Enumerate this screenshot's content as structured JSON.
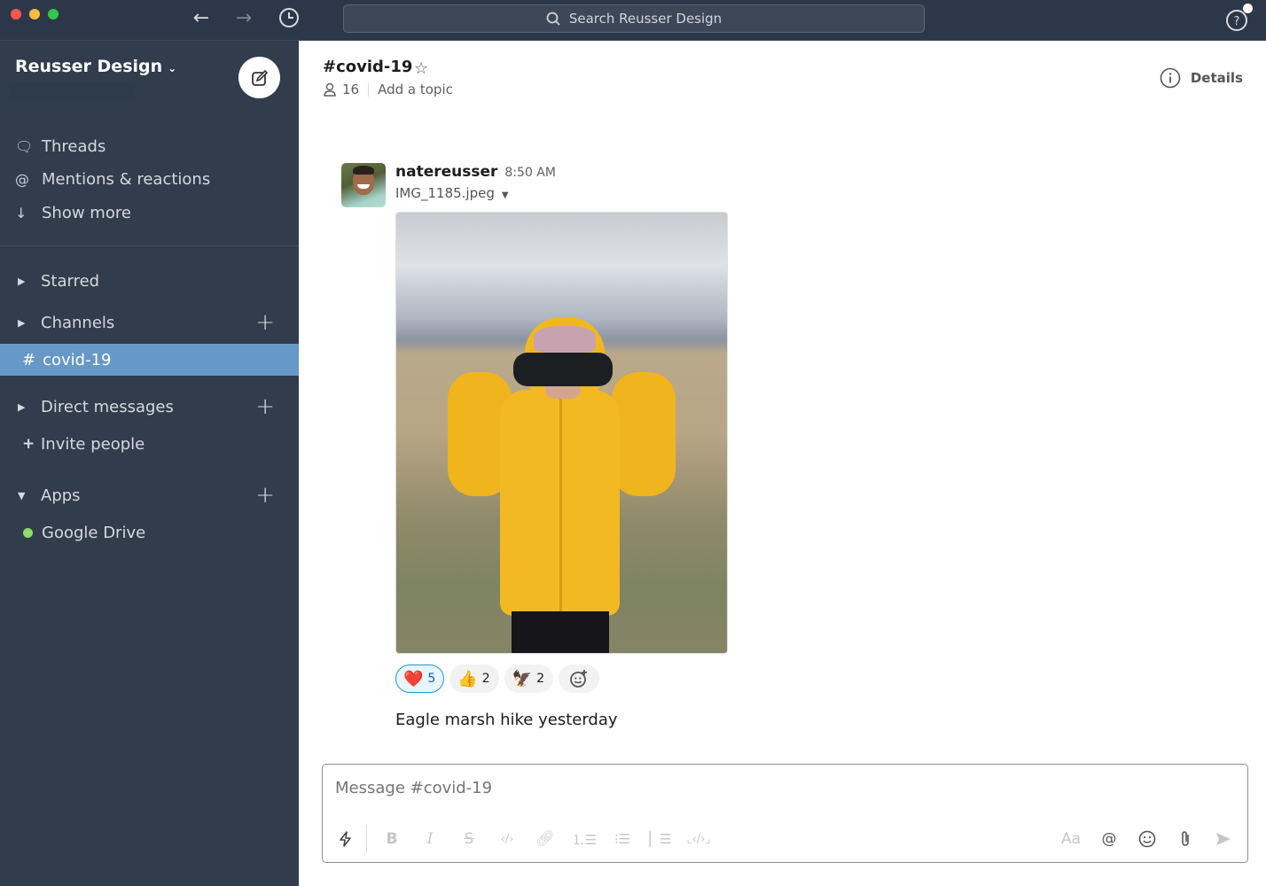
{
  "window": {
    "search_placeholder": "Search Reusser Design",
    "colors": {
      "titlebar": "#2c3849",
      "sidebar": "#313d4c",
      "active_channel": "#6698c8",
      "online": "#8cdd6b",
      "reaction_active": "#1d9bd1"
    }
  },
  "sidebar": {
    "workspace_name": "Reusser Design",
    "nav": [
      {
        "label": "Threads",
        "icon": "threads-icon"
      },
      {
        "label": "Mentions & reactions",
        "icon": "at-icon"
      },
      {
        "label": "Show more",
        "icon": "arrow-down-icon"
      }
    ],
    "sections": {
      "starred": "Starred",
      "channels": "Channels",
      "active_channel": "covid-19",
      "direct_messages": "Direct messages",
      "invite": "Invite people",
      "apps": "Apps",
      "app_items": [
        {
          "label": "Google Drive",
          "status": "online"
        }
      ]
    }
  },
  "header": {
    "channel_title": "#covid-19",
    "member_count": "16",
    "topic_placeholder": "Add a topic",
    "details_label": "Details"
  },
  "message": {
    "author": "natereusser",
    "time": "8:50 AM",
    "file_name": "IMG_1185.jpeg",
    "image_alt": "Child in a yellow puffer jacket looking through binoculars in a marsh field",
    "text": "Eagle marsh hike yesterday",
    "reactions": [
      {
        "emoji": "❤️",
        "name": "heart",
        "count": "5",
        "active": true
      },
      {
        "emoji": "👍",
        "name": "thumbsup",
        "count": "2",
        "active": false
      },
      {
        "emoji": "🦅",
        "name": "eagle",
        "count": "2",
        "active": false
      }
    ]
  },
  "composer": {
    "placeholder": "Message #covid-19",
    "format_label": "Aa"
  }
}
